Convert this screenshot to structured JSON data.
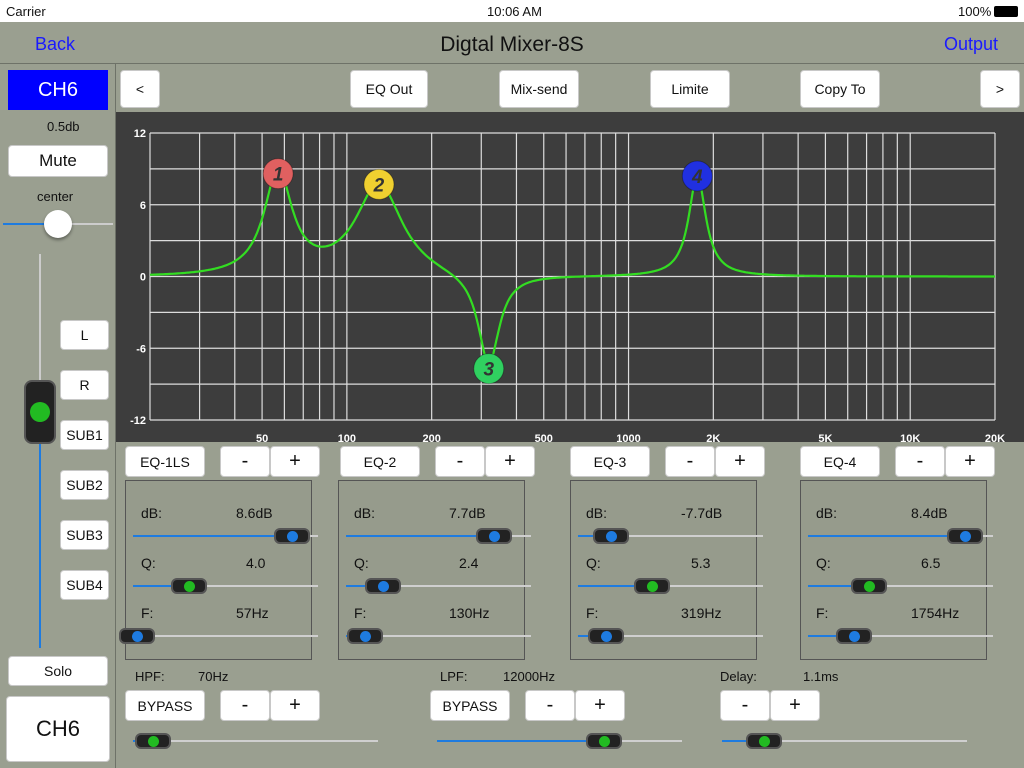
{
  "status": {
    "carrier": "Carrier",
    "time": "10:06 AM",
    "battery": "100%"
  },
  "nav": {
    "back": "Back",
    "title": "Digtal Mixer-8S",
    "output": "Output"
  },
  "channel": {
    "name": "CH6",
    "level": "0.5db",
    "mute": "Mute",
    "pan_label": "center",
    "pan_level": 0.5,
    "fader_level": 0.6,
    "routes": [
      "L",
      "R",
      "SUB1",
      "SUB2",
      "SUB3",
      "SUB4"
    ],
    "solo": "Solo",
    "bottom_name": "CH6"
  },
  "toolbar": {
    "prev": "<",
    "eq_out": "EQ Out",
    "mix_send": "Mix-send",
    "limite": "Limite",
    "copy_to": "Copy To",
    "next": ">"
  },
  "chart_data": {
    "type": "line",
    "xscale": "log",
    "xlim": [
      20,
      20000
    ],
    "ylim": [
      -12,
      12
    ],
    "yticks": [
      "12",
      "6",
      "0",
      "-6",
      "-12"
    ],
    "xticks": [
      {
        "v": 50,
        "t": "50"
      },
      {
        "v": 100,
        "t": "100"
      },
      {
        "v": 200,
        "t": "200"
      },
      {
        "v": 500,
        "t": "500"
      },
      {
        "v": 1000,
        "t": "1000"
      },
      {
        "v": 2000,
        "t": "2K"
      },
      {
        "v": 5000,
        "t": "5K"
      },
      {
        "v": 10000,
        "t": "10K"
      },
      {
        "v": 20000,
        "t": "20K"
      }
    ],
    "grid": true,
    "curve_color": "#33dd22",
    "nodes": [
      {
        "label": "1",
        "f": 57,
        "db": 8.6,
        "q": 4.0,
        "color": "#e06060"
      },
      {
        "label": "2",
        "f": 130,
        "db": 7.7,
        "q": 2.4,
        "color": "#f0d030"
      },
      {
        "label": "3",
        "f": 319,
        "db": -7.7,
        "q": 5.3,
        "color": "#30d060"
      },
      {
        "label": "4",
        "f": 1754,
        "db": 8.4,
        "q": 6.5,
        "color": "#2030e0"
      }
    ]
  },
  "bands": [
    {
      "name": "EQ-1LS",
      "db": "8.6dB",
      "q": "4.0",
      "f": "57Hz",
      "db_level": 0.86,
      "q_level": 0.3,
      "f_level": 0.02,
      "q_green": true
    },
    {
      "name": "EQ-2",
      "db": "7.7dB",
      "q": "2.4",
      "f": "130Hz",
      "db_level": 0.8,
      "q_level": 0.2,
      "f_level": 0.1,
      "q_green": false
    },
    {
      "name": "EQ-3",
      "db": "-7.7dB",
      "q": "5.3",
      "f": "319Hz",
      "db_level": 0.18,
      "q_level": 0.4,
      "f_level": 0.15,
      "q_green": true
    },
    {
      "name": "EQ-4",
      "db": "8.4dB",
      "q": "6.5",
      "f": "1754Hz",
      "db_level": 0.85,
      "q_level": 0.33,
      "f_level": 0.25,
      "q_green": true
    }
  ],
  "band_labels": {
    "db": "dB:",
    "q": "Q:",
    "f": "F:",
    "minus": "-",
    "plus": "+"
  },
  "hpf": {
    "label": "HPF:",
    "value": "70Hz",
    "bypass": "BYPASS",
    "level": 0.08
  },
  "lpf": {
    "label": "LPF:",
    "value": "12000Hz",
    "bypass": "BYPASS",
    "level": 0.68
  },
  "delay": {
    "label": "Delay:",
    "value": "1.1ms",
    "level": 0.17
  }
}
